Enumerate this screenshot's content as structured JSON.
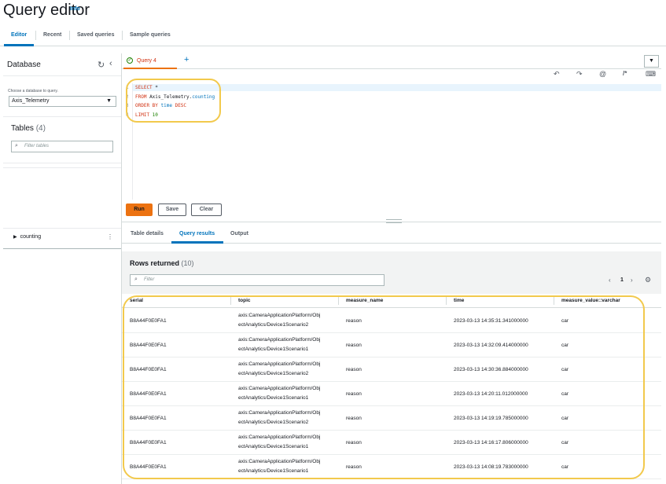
{
  "header": {
    "title": "Query editor",
    "info": "Info"
  },
  "tabs": [
    "Editor",
    "Recent",
    "Saved queries",
    "Sample queries"
  ],
  "sidebar": {
    "title": "Database",
    "choose_label": "Choose a database to query.",
    "database": "Axis_Telemetry",
    "tables_title": "Tables",
    "tables_count": "(4)",
    "filter_placeholder": "Filter tables",
    "table_item": "counting"
  },
  "query_tab": "Query 4",
  "code": {
    "line_numbers": [
      "1",
      "2",
      "3",
      "4"
    ],
    "select": "SELECT",
    "star": " *",
    "from": "FROM",
    "table_db": " Axis_Telemetry.",
    "table_name": "counting",
    "order_by": "ORDER BY",
    "time_col": " time",
    "desc": " DESC",
    "limit": "LIMIT",
    "limit_val": " 10"
  },
  "buttons": {
    "run": "Run",
    "save": "Save",
    "clear": "Clear"
  },
  "result_tabs": [
    "Table details",
    "Query results",
    "Output"
  ],
  "results": {
    "rows_returned_label": "Rows returned",
    "rows_returned_count": "(10)",
    "filter_placeholder": "Filter",
    "page": "1",
    "columns": [
      "serial",
      "topic",
      "measure_name",
      "time",
      "measure_value::varchar"
    ],
    "rows": [
      {
        "serial": "B8A44F0E0FA1",
        "topic1": "axis:CameraApplicationPlatform/Obj",
        "topic2": "ectAnalytics/Device1Scenario2",
        "measure_name": "reason",
        "time": "2023-03-13 14:35:31.341000000",
        "value": "car"
      },
      {
        "serial": "B8A44F0E0FA1",
        "topic1": "axis:CameraApplicationPlatform/Obj",
        "topic2": "ectAnalytics/Device1Scenario1",
        "measure_name": "reason",
        "time": "2023-03-13 14:32:09.414000000",
        "value": "car"
      },
      {
        "serial": "B8A44F0E0FA1",
        "topic1": "axis:CameraApplicationPlatform/Obj",
        "topic2": "ectAnalytics/Device1Scenario2",
        "measure_name": "reason",
        "time": "2023-03-13 14:30:36.884000000",
        "value": "car"
      },
      {
        "serial": "B8A44F0E0FA1",
        "topic1": "axis:CameraApplicationPlatform/Obj",
        "topic2": "ectAnalytics/Device1Scenario1",
        "measure_name": "reason",
        "time": "2023-03-13 14:20:11.012000000",
        "value": "car"
      },
      {
        "serial": "B8A44F0E0FA1",
        "topic1": "axis:CameraApplicationPlatform/Obj",
        "topic2": "ectAnalytics/Device1Scenario2",
        "measure_name": "reason",
        "time": "2023-03-13 14:19:19.785000000",
        "value": "car"
      },
      {
        "serial": "B8A44F0E0FA1",
        "topic1": "axis:CameraApplicationPlatform/Obj",
        "topic2": "ectAnalytics/Device1Scenario1",
        "measure_name": "reason",
        "time": "2023-03-13 14:16:17.806000000",
        "value": "car"
      },
      {
        "serial": "B8A44F0E0FA1",
        "topic1": "axis:CameraApplicationPlatform/Obj",
        "topic2": "ectAnalytics/Device1Scenario1",
        "measure_name": "reason",
        "time": "2023-03-13 14:08:19.783000000",
        "value": "car"
      }
    ]
  },
  "colors": {
    "accent": "#0073bb",
    "run": "#ec7211",
    "highlight_circle": "#f2c94c"
  }
}
